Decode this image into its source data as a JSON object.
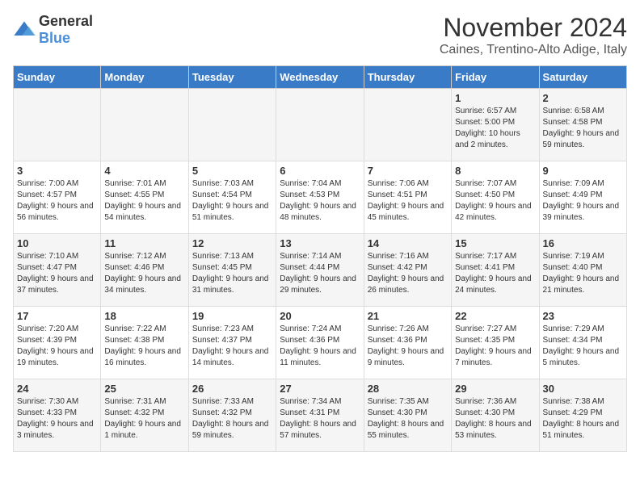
{
  "logo": {
    "general": "General",
    "blue": "Blue"
  },
  "title": "November 2024",
  "location": "Caines, Trentino-Alto Adige, Italy",
  "days_of_week": [
    "Sunday",
    "Monday",
    "Tuesday",
    "Wednesday",
    "Thursday",
    "Friday",
    "Saturday"
  ],
  "weeks": [
    [
      {
        "day": "",
        "info": ""
      },
      {
        "day": "",
        "info": ""
      },
      {
        "day": "",
        "info": ""
      },
      {
        "day": "",
        "info": ""
      },
      {
        "day": "",
        "info": ""
      },
      {
        "day": "1",
        "info": "Sunrise: 6:57 AM\nSunset: 5:00 PM\nDaylight: 10 hours and 2 minutes."
      },
      {
        "day": "2",
        "info": "Sunrise: 6:58 AM\nSunset: 4:58 PM\nDaylight: 9 hours and 59 minutes."
      }
    ],
    [
      {
        "day": "3",
        "info": "Sunrise: 7:00 AM\nSunset: 4:57 PM\nDaylight: 9 hours and 56 minutes."
      },
      {
        "day": "4",
        "info": "Sunrise: 7:01 AM\nSunset: 4:55 PM\nDaylight: 9 hours and 54 minutes."
      },
      {
        "day": "5",
        "info": "Sunrise: 7:03 AM\nSunset: 4:54 PM\nDaylight: 9 hours and 51 minutes."
      },
      {
        "day": "6",
        "info": "Sunrise: 7:04 AM\nSunset: 4:53 PM\nDaylight: 9 hours and 48 minutes."
      },
      {
        "day": "7",
        "info": "Sunrise: 7:06 AM\nSunset: 4:51 PM\nDaylight: 9 hours and 45 minutes."
      },
      {
        "day": "8",
        "info": "Sunrise: 7:07 AM\nSunset: 4:50 PM\nDaylight: 9 hours and 42 minutes."
      },
      {
        "day": "9",
        "info": "Sunrise: 7:09 AM\nSunset: 4:49 PM\nDaylight: 9 hours and 39 minutes."
      }
    ],
    [
      {
        "day": "10",
        "info": "Sunrise: 7:10 AM\nSunset: 4:47 PM\nDaylight: 9 hours and 37 minutes."
      },
      {
        "day": "11",
        "info": "Sunrise: 7:12 AM\nSunset: 4:46 PM\nDaylight: 9 hours and 34 minutes."
      },
      {
        "day": "12",
        "info": "Sunrise: 7:13 AM\nSunset: 4:45 PM\nDaylight: 9 hours and 31 minutes."
      },
      {
        "day": "13",
        "info": "Sunrise: 7:14 AM\nSunset: 4:44 PM\nDaylight: 9 hours and 29 minutes."
      },
      {
        "day": "14",
        "info": "Sunrise: 7:16 AM\nSunset: 4:42 PM\nDaylight: 9 hours and 26 minutes."
      },
      {
        "day": "15",
        "info": "Sunrise: 7:17 AM\nSunset: 4:41 PM\nDaylight: 9 hours and 24 minutes."
      },
      {
        "day": "16",
        "info": "Sunrise: 7:19 AM\nSunset: 4:40 PM\nDaylight: 9 hours and 21 minutes."
      }
    ],
    [
      {
        "day": "17",
        "info": "Sunrise: 7:20 AM\nSunset: 4:39 PM\nDaylight: 9 hours and 19 minutes."
      },
      {
        "day": "18",
        "info": "Sunrise: 7:22 AM\nSunset: 4:38 PM\nDaylight: 9 hours and 16 minutes."
      },
      {
        "day": "19",
        "info": "Sunrise: 7:23 AM\nSunset: 4:37 PM\nDaylight: 9 hours and 14 minutes."
      },
      {
        "day": "20",
        "info": "Sunrise: 7:24 AM\nSunset: 4:36 PM\nDaylight: 9 hours and 11 minutes."
      },
      {
        "day": "21",
        "info": "Sunrise: 7:26 AM\nSunset: 4:36 PM\nDaylight: 9 hours and 9 minutes."
      },
      {
        "day": "22",
        "info": "Sunrise: 7:27 AM\nSunset: 4:35 PM\nDaylight: 9 hours and 7 minutes."
      },
      {
        "day": "23",
        "info": "Sunrise: 7:29 AM\nSunset: 4:34 PM\nDaylight: 9 hours and 5 minutes."
      }
    ],
    [
      {
        "day": "24",
        "info": "Sunrise: 7:30 AM\nSunset: 4:33 PM\nDaylight: 9 hours and 3 minutes."
      },
      {
        "day": "25",
        "info": "Sunrise: 7:31 AM\nSunset: 4:32 PM\nDaylight: 9 hours and 1 minute."
      },
      {
        "day": "26",
        "info": "Sunrise: 7:33 AM\nSunset: 4:32 PM\nDaylight: 8 hours and 59 minutes."
      },
      {
        "day": "27",
        "info": "Sunrise: 7:34 AM\nSunset: 4:31 PM\nDaylight: 8 hours and 57 minutes."
      },
      {
        "day": "28",
        "info": "Sunrise: 7:35 AM\nSunset: 4:30 PM\nDaylight: 8 hours and 55 minutes."
      },
      {
        "day": "29",
        "info": "Sunrise: 7:36 AM\nSunset: 4:30 PM\nDaylight: 8 hours and 53 minutes."
      },
      {
        "day": "30",
        "info": "Sunrise: 7:38 AM\nSunset: 4:29 PM\nDaylight: 8 hours and 51 minutes."
      }
    ]
  ]
}
